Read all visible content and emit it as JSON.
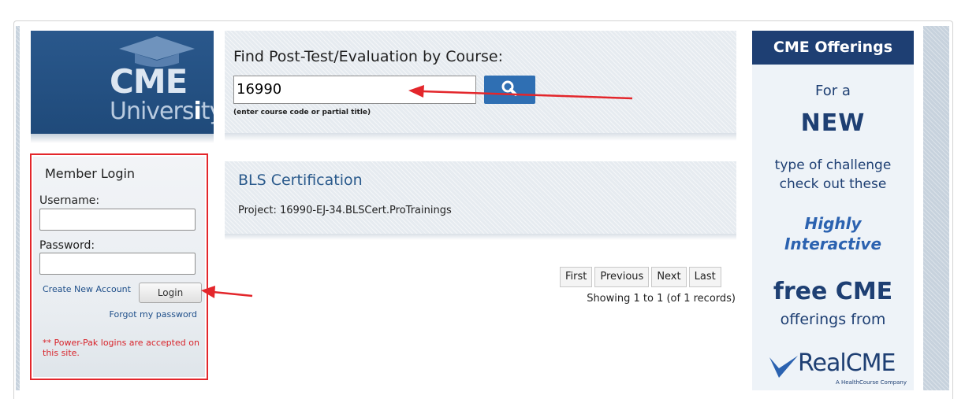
{
  "logo": {
    "line1": "CME",
    "line2_before": "Univers",
    "line2_i": "i",
    "line2_after": "ty"
  },
  "login": {
    "title": "Member Login",
    "username_label": "Username:",
    "password_label": "Password:",
    "create_account": "Create New Account",
    "login_button": "Login",
    "forgot_password": "Forgot my password",
    "powerpak_note": "** Power-Pak logins are accepted on this site."
  },
  "find": {
    "title": "Find Post-Test/Evaluation by Course:",
    "input_value": "16990",
    "hint": "(enter course code or partial title)"
  },
  "result": {
    "title": "BLS Certification",
    "project": "Project: 16990-EJ-34.BLSCert.ProTrainings"
  },
  "pager": {
    "first": "First",
    "previous": "Previous",
    "next": "Next",
    "last": "Last",
    "showing": "Showing 1 to 1 (of 1 records)"
  },
  "ad": {
    "header": "CME Offerings",
    "line1": "For a",
    "line2": "NEW",
    "line3": "type of challenge check out these",
    "line4": "Highly Interactive",
    "line5": "free CME",
    "line6": "offerings from",
    "brand_real": "Real",
    "brand_cme": "CME",
    "brand_sub": "A HealthCourse Company"
  },
  "colors": {
    "annotation_red": "#e3262b",
    "brand_navy": "#1e3f73",
    "search_blue": "#2f6fb3"
  }
}
